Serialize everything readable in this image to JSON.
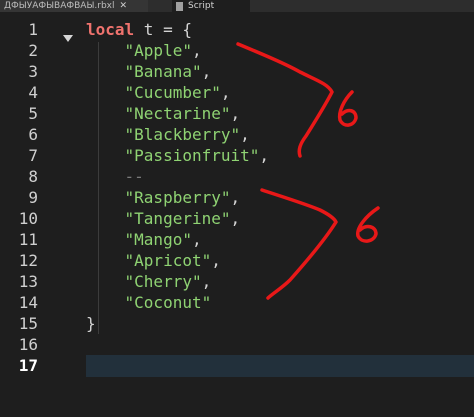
{
  "tabs": [
    {
      "label": "ДФЫУАФЫВАФВАЫ.rbxl",
      "close": "✕"
    },
    {
      "label": "Script",
      "close": "✕"
    }
  ],
  "editor": {
    "line_numbers": [
      "1",
      "2",
      "3",
      "4",
      "5",
      "6",
      "7",
      "8",
      "9",
      "10",
      "11",
      "12",
      "13",
      "14",
      "15",
      "16",
      "17"
    ],
    "current_line": "17",
    "code": {
      "keyword": "local",
      "decl_rest": " t = {",
      "items": [
        "\"Apple\"",
        "\"Banana\"",
        "\"Cucumber\"",
        "\"Nectarine\"",
        "\"Blackberry\"",
        "\"Passionfruit\"",
        "\"Raspberry\"",
        "\"Tangerine\"",
        "\"Mango\"",
        "\"Apricot\"",
        "\"Cherry\"",
        "\"Coconut\""
      ],
      "comma": ",",
      "comment": "--",
      "close_brace": "}"
    }
  },
  "annotations": {
    "group1": "6",
    "group2": "6",
    "color": "#e81818"
  },
  "colors": {
    "keyword": "#f0736e",
    "string": "#8fd373",
    "background": "#1e1e1e"
  }
}
